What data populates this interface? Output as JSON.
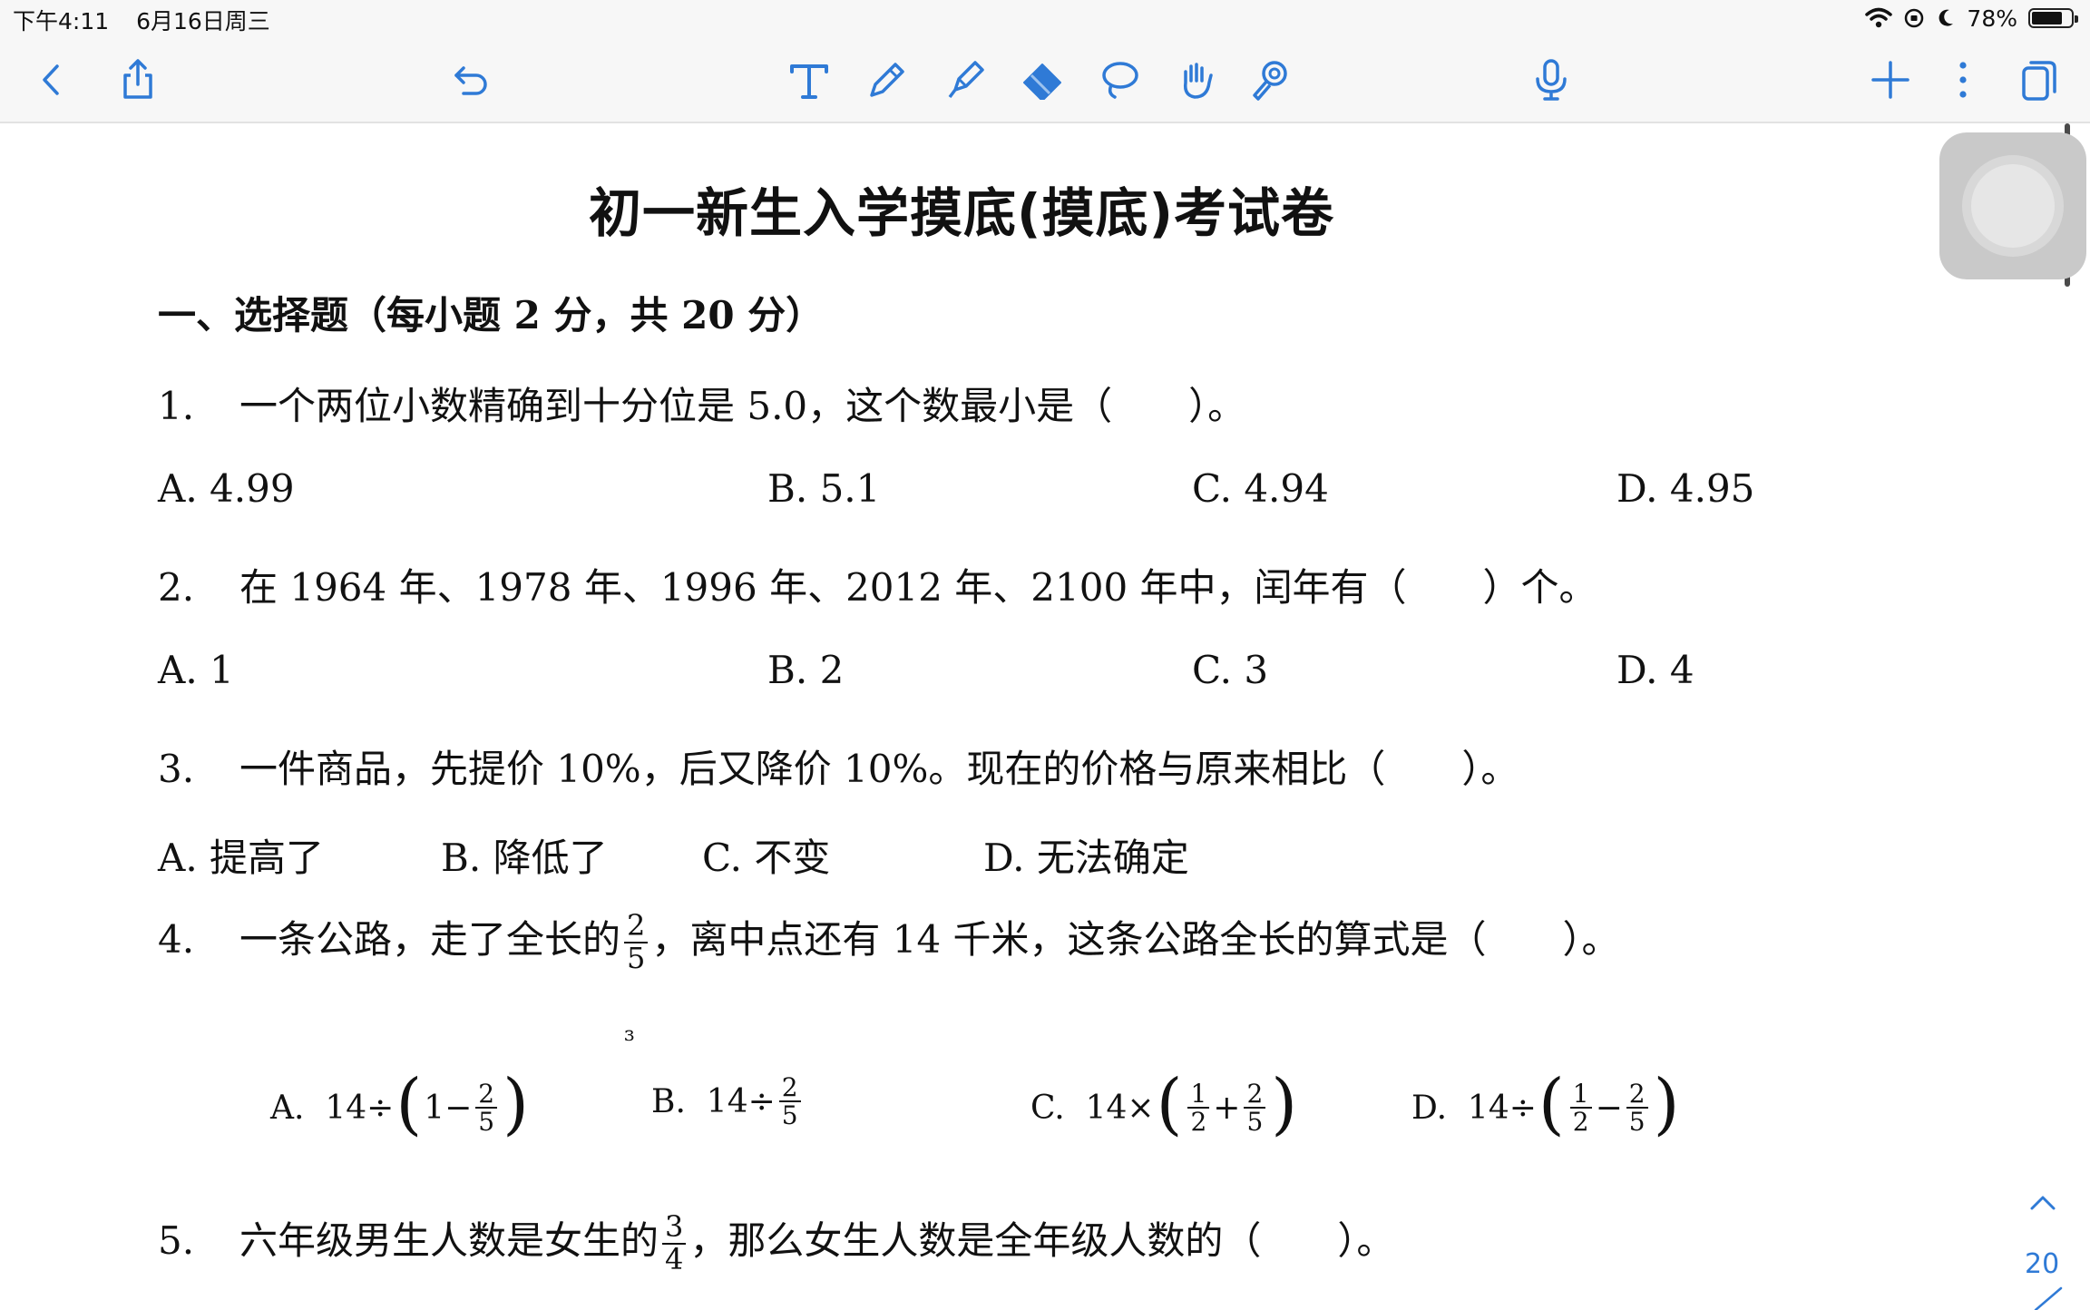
{
  "status_bar": {
    "time": "下午4:11",
    "date": "6月16日周三",
    "battery_text": "78%",
    "battery_level": 0.78
  },
  "toolbar": {
    "left": [
      "back-icon",
      "share-icon",
      "undo-icon"
    ],
    "tools": [
      "text-tool-icon",
      "pen-icon",
      "highlighter-icon",
      "eraser-icon",
      "lasso-icon",
      "hand-icon",
      "laser-pointer-icon"
    ],
    "right": [
      "microphone-icon",
      "add-page-icon",
      "more-icon",
      "pages-icon"
    ],
    "accent_color": "#2f7ad6"
  },
  "document": {
    "title": "初一新生入学摸底(摸底)考试卷",
    "section_heading": "一、选择题（每小题 2 分，共 20 分）",
    "stray_mark": "ɜ",
    "q1": {
      "number": "1.",
      "text": "一个两位小数精确到十分位是 5.0，这个数最小是（　　）。",
      "options": [
        "A. 4.99",
        "B. 5.1",
        "C. 4.94",
        "D. 4.95"
      ]
    },
    "q2": {
      "number": "2.",
      "text": "在 1964 年、1978 年、1996 年、2012 年、2100 年中，闰年有（　　）个。",
      "options": [
        "A. 1",
        "B. 2",
        "C. 3",
        "D. 4"
      ]
    },
    "q3": {
      "number": "3.",
      "text": "一件商品，先提价 10%，后又降价 10%。现在的价格与原来相比（　　）。",
      "options": [
        "A.  提高了",
        "B.  降低了",
        "C.  不变",
        "D.  无法确定"
      ]
    },
    "q4": {
      "number": "4.",
      "text_before": "一条公路，走了全长的",
      "frac": {
        "num": "2",
        "den": "5"
      },
      "text_after": "，离中点还有 14 千米，这条公路全长的算式是（　　）。",
      "options": {
        "a_label": "A.",
        "a_expr": "14÷",
        "a_inner": "1−",
        "a_frac": {
          "num": "2",
          "den": "5"
        },
        "b_label": "B.",
        "b_expr": "14÷",
        "b_frac": {
          "num": "2",
          "den": "5"
        },
        "c_label": "C.",
        "c_expr": "14×",
        "c_frac1": {
          "num": "1",
          "den": "2"
        },
        "c_op": "+",
        "c_frac2": {
          "num": "2",
          "den": "5"
        },
        "d_label": "D.",
        "d_expr": "14÷",
        "d_frac1": {
          "num": "1",
          "den": "2"
        },
        "d_op": "−",
        "d_frac2": {
          "num": "2",
          "den": "5"
        },
        "lparen": "(",
        "rparen": ")"
      }
    },
    "q5": {
      "number": "5.",
      "text_before": "六年级男生人数是女生的",
      "frac": {
        "num": "3",
        "den": "4"
      },
      "text_after": "，那么女生人数是全年级人数的（　　）。"
    }
  },
  "sidebar": {
    "page_number": "20"
  }
}
